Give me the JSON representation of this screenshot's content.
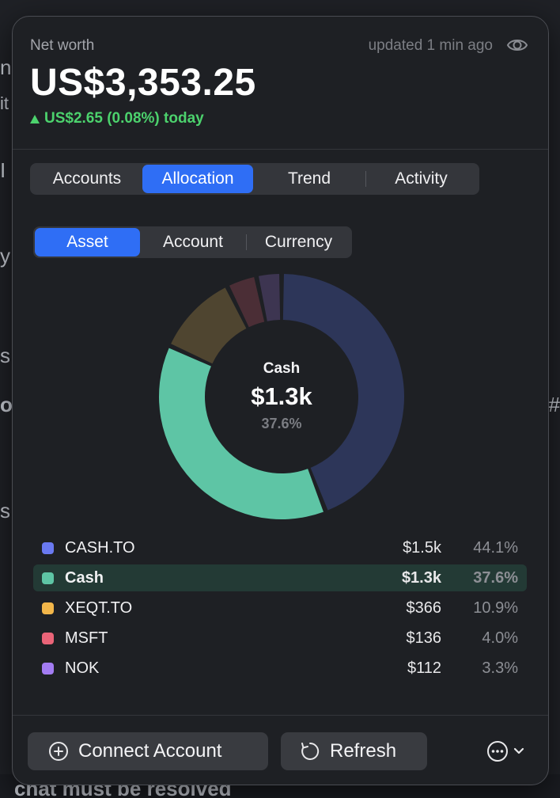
{
  "header": {
    "label": "Net worth",
    "updated": "updated 1 min ago",
    "value": "US$3,353.25",
    "change": "US$2.65 (0.08%) today"
  },
  "tabs": [
    {
      "label": "Accounts",
      "selected": false
    },
    {
      "label": "Allocation",
      "selected": true
    },
    {
      "label": "Trend",
      "selected": false
    },
    {
      "label": "Activity",
      "selected": false
    }
  ],
  "group_by": [
    {
      "label": "Asset",
      "selected": true
    },
    {
      "label": "Account",
      "selected": false
    },
    {
      "label": "Currency",
      "selected": false
    }
  ],
  "donut_center": {
    "name": "Cash",
    "value": "$1.3k",
    "pct": "37.6%"
  },
  "legend": [
    {
      "name": "CASH.TO",
      "value": "$1.5k",
      "pct": "44.1%",
      "share": 44.1,
      "color": "#6a79f0",
      "slice": "#2d3659",
      "highlighted": false
    },
    {
      "name": "Cash",
      "value": "$1.3k",
      "pct": "37.6%",
      "share": 37.6,
      "color": "#5ec5a5",
      "slice": "#5ec5a5",
      "highlighted": true
    },
    {
      "name": "XEQT.TO",
      "value": "$366",
      "pct": "10.9%",
      "share": 10.9,
      "color": "#f2b64a",
      "slice": "#4f4530",
      "highlighted": false
    },
    {
      "name": "MSFT",
      "value": "$136",
      "pct": "4.0%",
      "share": 4.0,
      "color": "#ea6478",
      "slice": "#4b2e36",
      "highlighted": false
    },
    {
      "name": "NOK",
      "value": "$112",
      "pct": "3.3%",
      "share": 3.3,
      "color": "#a37cf2",
      "slice": "#3d3551",
      "highlighted": false
    }
  ],
  "footer": {
    "connect_label": "Connect Account",
    "refresh_label": "Refresh"
  },
  "background": {
    "bottom_text": "chat must be resolved"
  },
  "colors": {
    "accent": "#2f6ef5",
    "positive": "#4cd26d",
    "highlight_row": "#233a35"
  }
}
